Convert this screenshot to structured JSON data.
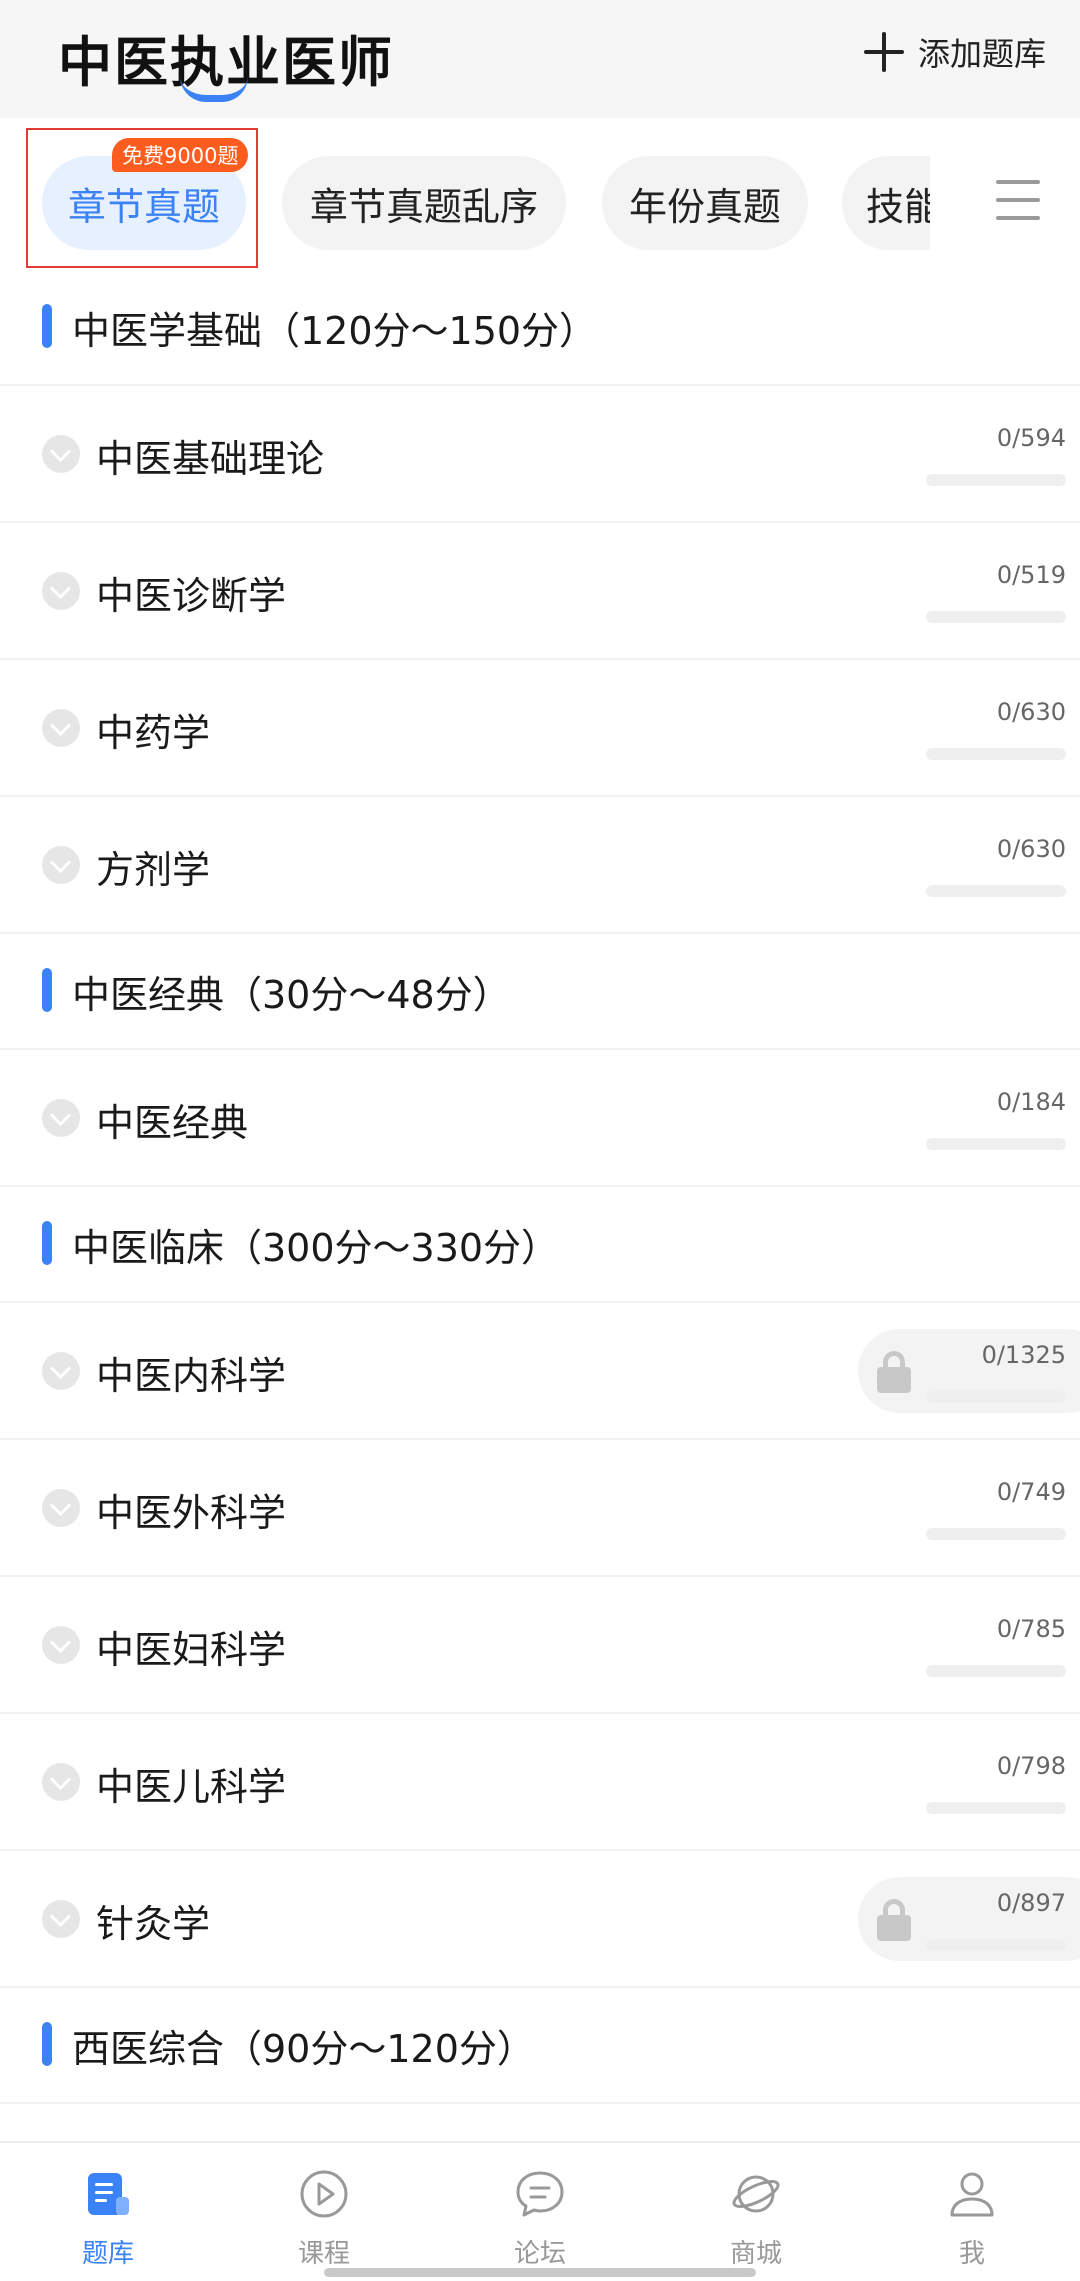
{
  "header": {
    "title": "中医执业医师",
    "add_label": "添加题库"
  },
  "tabs": [
    {
      "label": "章节真题",
      "active": true,
      "badge": "免费9000题"
    },
    {
      "label": "章节真题乱序",
      "active": false
    },
    {
      "label": "年份真题",
      "active": false
    },
    {
      "label": "技能真题",
      "active": false
    }
  ],
  "sections": [
    {
      "title": "中医学基础（120分～150分）",
      "items": [
        {
          "name": "中医基础理论",
          "count": "0/594",
          "locked": false
        },
        {
          "name": "中医诊断学",
          "count": "0/519",
          "locked": false
        },
        {
          "name": "中药学",
          "count": "0/630",
          "locked": false
        },
        {
          "name": "方剂学",
          "count": "0/630",
          "locked": false
        }
      ]
    },
    {
      "title": "中医经典（30分～48分）",
      "items": [
        {
          "name": "中医经典",
          "count": "0/184",
          "locked": false
        }
      ]
    },
    {
      "title": "中医临床（300分～330分）",
      "items": [
        {
          "name": "中医内科学",
          "count": "0/1325",
          "locked": true
        },
        {
          "name": "中医外科学",
          "count": "0/749",
          "locked": false
        },
        {
          "name": "中医妇科学",
          "count": "0/785",
          "locked": false
        },
        {
          "name": "中医儿科学",
          "count": "0/798",
          "locked": false
        },
        {
          "name": "针灸学",
          "count": "0/897",
          "locked": true
        }
      ]
    },
    {
      "title": "西医综合（90分～120分）",
      "items": []
    }
  ],
  "bottom_nav": [
    {
      "label": "题库",
      "icon": "question-bank-icon",
      "active": true
    },
    {
      "label": "课程",
      "icon": "play-circle-icon",
      "active": false
    },
    {
      "label": "论坛",
      "icon": "chat-bubble-icon",
      "active": false
    },
    {
      "label": "商城",
      "icon": "planet-icon",
      "active": false
    },
    {
      "label": "我",
      "icon": "person-icon",
      "active": false
    }
  ],
  "colors": {
    "accent": "#3b82f6",
    "badge": "#ff5d1f",
    "highlight": "#e53935"
  }
}
